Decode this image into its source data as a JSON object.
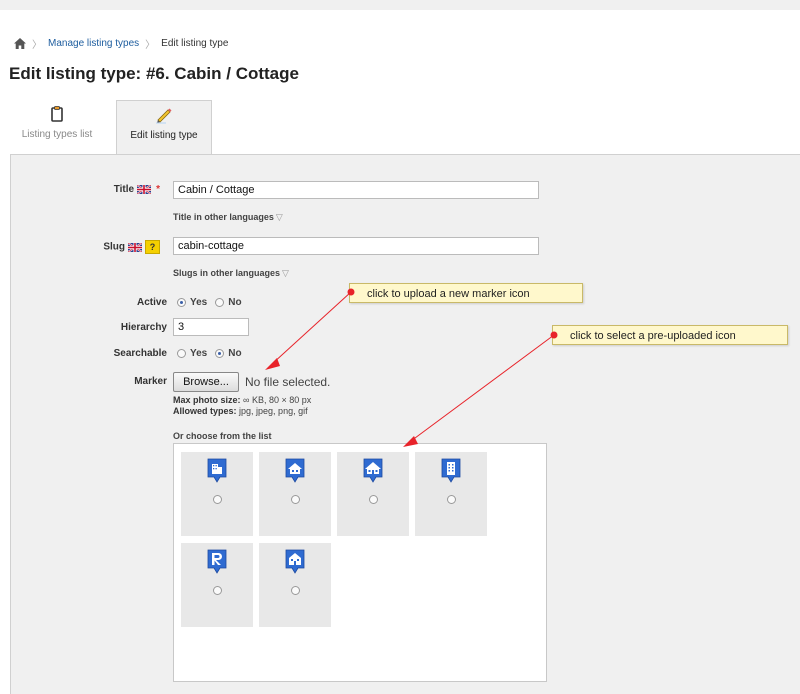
{
  "breadcrumb": {
    "link": "Manage listing types",
    "current": "Edit listing type"
  },
  "page_title": "Edit listing type: #6. Cabin / Cottage",
  "tabs": [
    {
      "label": "Listing types list",
      "icon": "clipboard-icon",
      "active": false
    },
    {
      "label": "Edit listing type",
      "icon": "pencil-icon",
      "active": true
    }
  ],
  "form": {
    "title_label": "Title",
    "title_value": "Cabin / Cottage",
    "title_other_langs": "Title in other languages",
    "slug_label": "Slug",
    "slug_help": "?",
    "slug_value": "cabin-cottage",
    "slug_other_langs": "Slugs in other languages",
    "active_label": "Active",
    "active_options": [
      "Yes",
      "No"
    ],
    "active_selected": "Yes",
    "hierarchy_label": "Hierarchy",
    "hierarchy_value": "3",
    "searchable_label": "Searchable",
    "searchable_options": [
      "Yes",
      "No"
    ],
    "searchable_selected": "No",
    "marker_label": "Marker",
    "browse_label": "Browse...",
    "no_file": "No file selected.",
    "max_size_label": "Max photo size:",
    "max_size_value": "∞ KB, 80 × 80 px",
    "allowed_label": "Allowed types:",
    "allowed_value": "jpg, jpeg, png, gif",
    "choose_label": "Or choose from the list"
  },
  "icon_list": [
    {
      "icon": "office-building-marker-icon",
      "selected": false
    },
    {
      "icon": "house-marker-icon",
      "selected": false
    },
    {
      "icon": "cabin-marker-icon",
      "selected": false
    },
    {
      "icon": "tower-building-marker-icon",
      "selected": false
    },
    {
      "icon": "realtor-r-marker-icon",
      "selected": false
    },
    {
      "icon": "home-marker-icon",
      "selected": false
    }
  ],
  "callouts": {
    "upload": "click to upload a new marker icon",
    "select": "click to select a pre-uploaded icon"
  },
  "colors": {
    "link": "#1c5c9e",
    "marker_blue": "#2f6bd1",
    "callout_bg": "#fff8cc",
    "arrow": "#e8232a",
    "required": "#dd3333"
  }
}
